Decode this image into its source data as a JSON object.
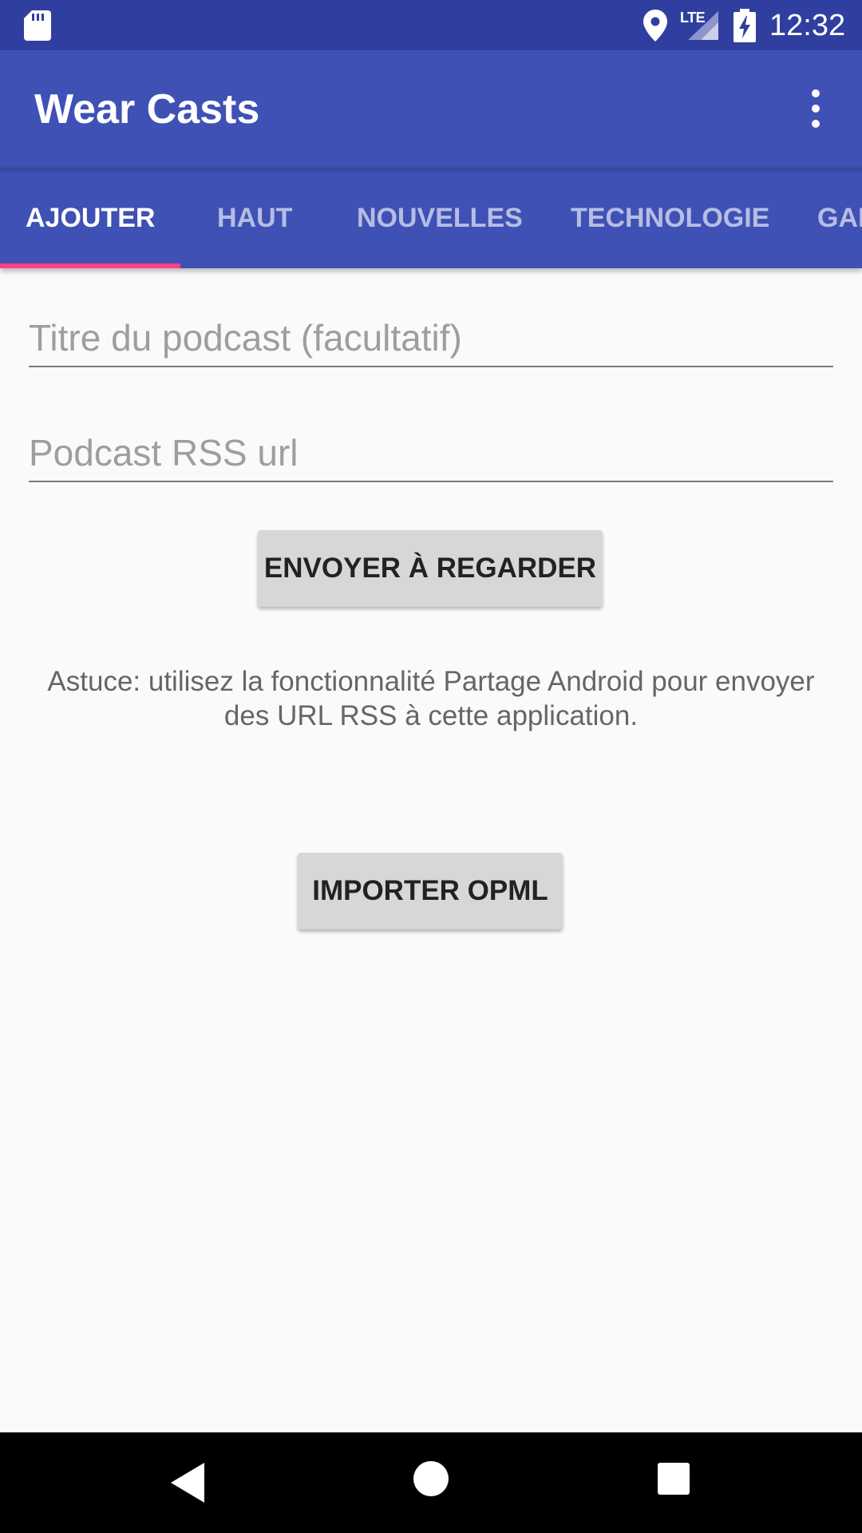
{
  "status_bar": {
    "network_label": "LTE",
    "time": "12:32"
  },
  "app_bar": {
    "title": "Wear Casts",
    "overflow_icon": "more-vert-icon"
  },
  "tabs": [
    {
      "label": "AJOUTER",
      "active": true
    },
    {
      "label": "HAUT",
      "active": false
    },
    {
      "label": "NOUVELLES",
      "active": false
    },
    {
      "label": "TECHNOLOGIE",
      "active": false
    },
    {
      "label": "GAI",
      "active": false
    }
  ],
  "form": {
    "title_placeholder": "Titre du podcast (facultatif)",
    "title_value": "",
    "url_placeholder": "Podcast RSS url",
    "url_value": "",
    "send_label": "ENVOYER À REGARDER",
    "tip_line1": "Astuce: utilisez la fonctionnalité Partage Android pour envoyer",
    "tip_line2": "des URL RSS à cette application.",
    "import_label": "IMPORTER OPML"
  },
  "colors": {
    "status_bar": "#303F9F",
    "primary": "#3F51B5",
    "accent": "#FF4081",
    "background": "#FAFAFA",
    "button": "#D6D7D7"
  }
}
